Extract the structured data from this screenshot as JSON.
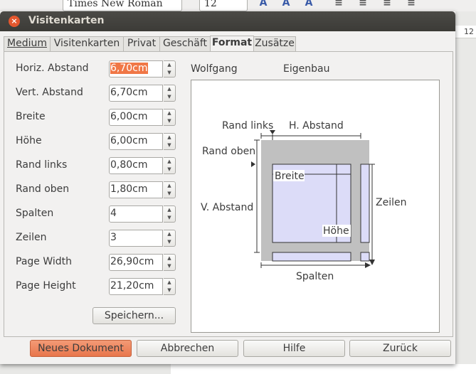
{
  "background": {
    "font_name": "Times New Roman",
    "font_size": "12",
    "toolbar_glyphs": [
      "A",
      "A",
      "A"
    ],
    "ruler_mark": "12"
  },
  "window": {
    "title": "Visitenkarten",
    "close_glyph": "×"
  },
  "tabs": [
    "Medium",
    "Visitenkarten",
    "Privat",
    "Geschäft",
    "Format",
    "Zusätze"
  ],
  "active_tab": "Format",
  "fields": [
    {
      "label": "Horiz. Abstand",
      "value": "6,70cm"
    },
    {
      "label": "Vert. Abstand",
      "value": "6,70cm"
    },
    {
      "label": "Breite",
      "value": "6,00cm"
    },
    {
      "label": "Höhe",
      "value": "6,00cm"
    },
    {
      "label": "Rand links",
      "value": "0,80cm"
    },
    {
      "label": "Rand oben",
      "value": "1,80cm"
    },
    {
      "label": "Spalten",
      "value": "4"
    },
    {
      "label": "Zeilen",
      "value": "3"
    },
    {
      "label": "Page Width",
      "value": "26,90cm"
    },
    {
      "label": "Page Height",
      "value": "21,20cm"
    }
  ],
  "spin_up_glyph": "▲",
  "spin_down_glyph": "▼",
  "save_button": "Speichern...",
  "preview": {
    "manufacturer": "Wolfgang",
    "type": "Eigenbau",
    "labels": {
      "rand_links": "Rand links",
      "h_abstand": "H. Abstand",
      "rand_oben": "Rand oben",
      "breite": "Breite",
      "v_abstand": "V. Abstand",
      "zeilen": "Zeilen",
      "hoehe": "Höhe",
      "spalten": "Spalten"
    }
  },
  "footer": {
    "new_document": "Neues Dokument",
    "cancel": "Abbrechen",
    "help": "Hilfe",
    "back": "Zurück"
  },
  "colors": {
    "accent": "#e8764b",
    "label_fill": "#dcdcf8",
    "page_gray": "#c0c0c0"
  }
}
